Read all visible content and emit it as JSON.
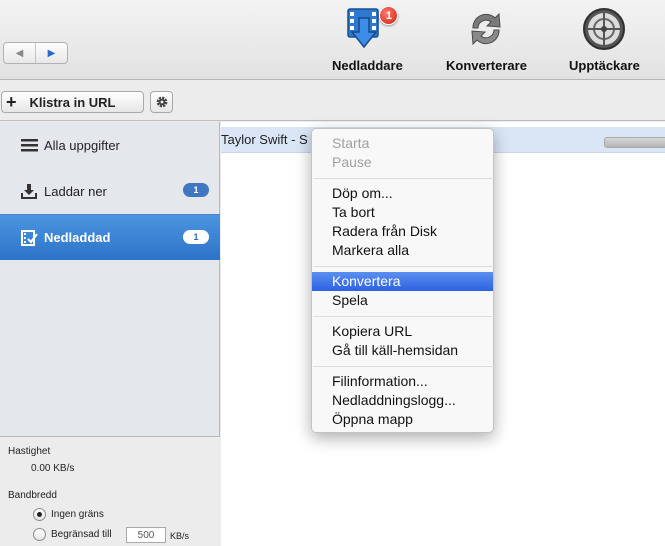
{
  "toolbar": {
    "download_label": "Nedladdare",
    "download_badge": "1",
    "convert_label": "Konverterare",
    "discover_label": "Upptäckare",
    "nav_back": "◀",
    "nav_forward": "▶"
  },
  "urlbar": {
    "paste_label": "Klistra in URL",
    "paste_icon": "+"
  },
  "sidebar": {
    "items": [
      {
        "label": "Alla uppgifter",
        "icon": "list-icon"
      },
      {
        "label": "Laddar ner",
        "icon": "download-tray-icon",
        "count": "1"
      },
      {
        "label": "Nedladdad",
        "icon": "film-check-icon",
        "count": "1",
        "selected": true
      }
    ]
  },
  "stats": {
    "speed_label": "Hastighet",
    "speed_value": "0.00 KB/s",
    "bandwidth_label": "Bandbredd",
    "no_limit_label": "Ingen gräns",
    "limited_label": "Begränsad till",
    "limit_value": "500",
    "limit_unit": "KB/s"
  },
  "list": {
    "rows": [
      {
        "title": "Taylor Swift - S"
      }
    ]
  },
  "context_menu": {
    "groups": [
      [
        {
          "label": "Starta",
          "disabled": true
        },
        {
          "label": "Pause",
          "disabled": true
        }
      ],
      [
        {
          "label": "Döp om..."
        },
        {
          "label": "Ta bort"
        },
        {
          "label": "Radera från Disk"
        },
        {
          "label": "Markera alla"
        }
      ],
      [
        {
          "label": "Konvertera",
          "highlighted": true
        },
        {
          "label": "Spela"
        }
      ],
      [
        {
          "label": "Kopiera URL"
        },
        {
          "label": "Gå till käll-hemsidan"
        }
      ],
      [
        {
          "label": "Filinformation..."
        },
        {
          "label": "Nedladdningslogg..."
        },
        {
          "label": "Öppna mapp"
        }
      ]
    ]
  },
  "colors": {
    "selection_blue": "#2c73c9",
    "menu_highlight": "#2d62e2",
    "badge_red": "#d11d0f"
  }
}
